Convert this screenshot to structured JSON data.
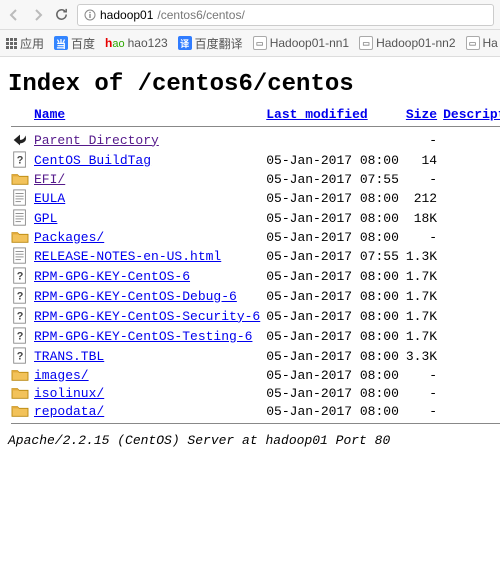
{
  "browser": {
    "url_host": "hadoop01",
    "url_path": "/centos6/centos/"
  },
  "bookmarks": {
    "apps": "应用",
    "baidu": "百度",
    "hao123": "hao123",
    "baidu_fanyi": "百度翻译",
    "hadoop_nn1": "Hadoop01-nn1",
    "hadoop_nn2": "Hadoop01-nn2",
    "ha": "Ha"
  },
  "page": {
    "title": "Index of /centos6/centos",
    "headers": {
      "name": "Name",
      "last_modified": "Last modified",
      "size": "Size",
      "description": "Description"
    },
    "parent": {
      "label": "Parent Directory",
      "size": "-"
    },
    "rows": [
      {
        "name": "CentOS_BuildTag",
        "mod": "05-Jan-2017 08:00",
        "size": "14",
        "icon": "unknown",
        "visited": false
      },
      {
        "name": "EFI/",
        "mod": "05-Jan-2017 07:55",
        "size": "-",
        "icon": "folder",
        "visited": true
      },
      {
        "name": "EULA",
        "mod": "05-Jan-2017 08:00",
        "size": "212",
        "icon": "text",
        "visited": false
      },
      {
        "name": "GPL",
        "mod": "05-Jan-2017 08:00",
        "size": "18K",
        "icon": "text",
        "visited": false
      },
      {
        "name": "Packages/",
        "mod": "05-Jan-2017 08:00",
        "size": "-",
        "icon": "folder",
        "visited": false
      },
      {
        "name": "RELEASE-NOTES-en-US.html",
        "mod": "05-Jan-2017 07:55",
        "size": "1.3K",
        "icon": "text",
        "visited": false
      },
      {
        "name": "RPM-GPG-KEY-CentOS-6",
        "mod": "05-Jan-2017 08:00",
        "size": "1.7K",
        "icon": "unknown",
        "visited": false
      },
      {
        "name": "RPM-GPG-KEY-CentOS-Debug-6",
        "mod": "05-Jan-2017 08:00",
        "size": "1.7K",
        "icon": "unknown",
        "visited": false
      },
      {
        "name": "RPM-GPG-KEY-CentOS-Security-6",
        "mod": "05-Jan-2017 08:00",
        "size": "1.7K",
        "icon": "unknown",
        "visited": false
      },
      {
        "name": "RPM-GPG-KEY-CentOS-Testing-6",
        "mod": "05-Jan-2017 08:00",
        "size": "1.7K",
        "icon": "unknown",
        "visited": false
      },
      {
        "name": "TRANS.TBL",
        "mod": "05-Jan-2017 08:00",
        "size": "3.3K",
        "icon": "unknown",
        "visited": false
      },
      {
        "name": "images/",
        "mod": "05-Jan-2017 08:00",
        "size": "-",
        "icon": "folder",
        "visited": false
      },
      {
        "name": "isolinux/",
        "mod": "05-Jan-2017 08:00",
        "size": "-",
        "icon": "folder",
        "visited": false
      },
      {
        "name": "repodata/",
        "mod": "05-Jan-2017 08:00",
        "size": "-",
        "icon": "folder",
        "visited": false
      }
    ],
    "footer": "Apache/2.2.15 (CentOS) Server at hadoop01 Port 80"
  }
}
